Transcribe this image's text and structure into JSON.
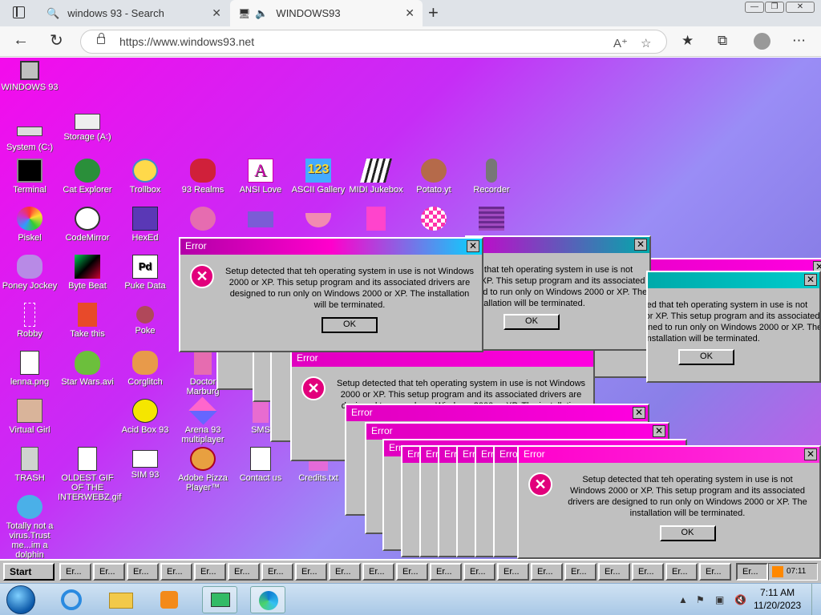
{
  "browser": {
    "tabs": [
      {
        "title": "windows 93 - Search"
      },
      {
        "title": "WINDOWS93"
      }
    ],
    "url": "https://www.windows93.net"
  },
  "desktop_icons": [
    {
      "label": "WINDOWS 93",
      "icon": "computer-icon"
    },
    {
      "label": "System (C:)",
      "icon": "drive-icon"
    },
    {
      "label": "Storage (A:)",
      "icon": "floppy-icon"
    },
    {
      "label": "Terminal",
      "icon": "terminal-icon"
    },
    {
      "label": "Cat Explorer",
      "icon": "cat-globe-icon"
    },
    {
      "label": "Trollbox",
      "icon": "trollbox-icon"
    },
    {
      "label": "93 Realms",
      "icon": "realms-icon"
    },
    {
      "label": "ANSI Love",
      "icon": "ansi-icon"
    },
    {
      "label": "ASCII Gallery",
      "icon": "ascii-icon"
    },
    {
      "label": "MIDI Jukebox",
      "icon": "piano-icon"
    },
    {
      "label": "Potato.yt",
      "icon": "potato-icon"
    },
    {
      "label": "Recorder",
      "icon": "microphone-icon"
    },
    {
      "label": "Piskel",
      "icon": "palette-icon"
    },
    {
      "label": "CodeMirror",
      "icon": "codemirror-icon"
    },
    {
      "label": "HexEd",
      "icon": "hex-icon"
    },
    {
      "label": "Poney Jockey",
      "icon": "pony-icon"
    },
    {
      "label": "Byte Beat",
      "icon": "bytebeat-icon"
    },
    {
      "label": "Puke Data",
      "icon": "pukedata-icon"
    },
    {
      "label": "Robby",
      "icon": "robby-icon"
    },
    {
      "label": "Take this",
      "icon": "takethis-icon"
    },
    {
      "label": "Poke",
      "icon": "poke-icon"
    },
    {
      "label": "lenna.png",
      "icon": "image-file-icon"
    },
    {
      "label": "Star Wars.avi",
      "icon": "yoda-icon"
    },
    {
      "label": "Corglitch",
      "icon": "corgi-icon"
    },
    {
      "label": "Doctor Marburg",
      "icon": "doctor-icon"
    },
    {
      "label": "Virtual Girl",
      "icon": "girl-icon"
    },
    {
      "label": "Acid Box 93",
      "icon": "smiley-icon"
    },
    {
      "label": "Arena 93 multiplayer",
      "icon": "cube-icon"
    },
    {
      "label": "SMS",
      "icon": "sms-icon"
    },
    {
      "label": "TRASH",
      "icon": "trash-icon"
    },
    {
      "label": "OLDEST GIF OF THE INTERWEBZ.gif",
      "icon": "gif-file-icon"
    },
    {
      "label": "SIM 93",
      "icon": "sim-icon"
    },
    {
      "label": "Adobe Pizza Player™",
      "icon": "pizza-icon"
    },
    {
      "label": "Contact us",
      "icon": "contact-icon"
    },
    {
      "label": "Credits.txt",
      "icon": "text-file-icon"
    },
    {
      "label": "Totally not a virus.Trust me...im a dolphin",
      "icon": "dolphin-icon"
    }
  ],
  "error_dialog": {
    "title": "Error",
    "message": "Setup detected that teh operating system in use is not Windows 2000 or XP. This setup program and its associated drivers are designed to run only on Windows 2000 or XP. The installation will be terminated.",
    "ok_label": "OK"
  },
  "w93_taskbar": {
    "start_label": "Start",
    "task_label": "Er...",
    "tray_time": "07:11"
  },
  "win7_taskbar": {
    "time": "7:11 AM",
    "date": "11/20/2023"
  }
}
